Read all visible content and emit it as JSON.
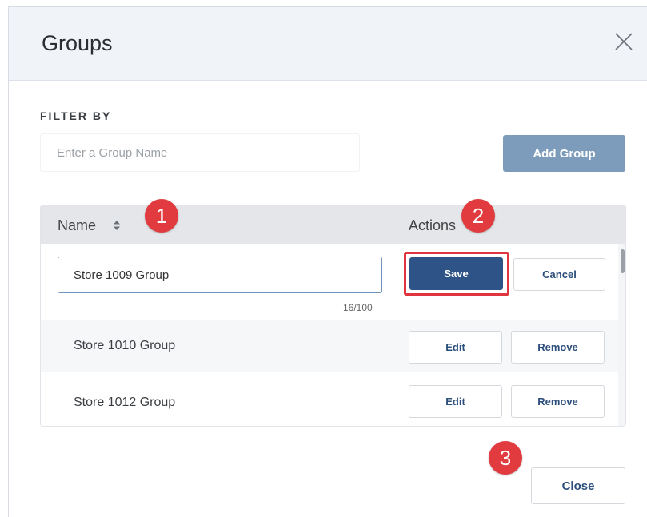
{
  "dialog": {
    "title": "Groups",
    "close_icon": "close-icon"
  },
  "filter": {
    "label": "FILTER BY",
    "placeholder": "Enter a Group Name",
    "add_button": "Add Group"
  },
  "table": {
    "columns": {
      "name": "Name",
      "actions": "Actions",
      "sort_icon": "sort-icon"
    },
    "editing_row": {
      "value": "Store 1009 Group",
      "char_count": "16/100",
      "save_label": "Save",
      "cancel_label": "Cancel"
    },
    "rows": [
      {
        "name": "Store 1010 Group",
        "edit_label": "Edit",
        "remove_label": "Remove"
      },
      {
        "name": "Store 1012 Group",
        "edit_label": "Edit",
        "remove_label": "Remove"
      }
    ]
  },
  "footer": {
    "close_label": "Close"
  },
  "callouts": [
    "1",
    "2",
    "3"
  ],
  "colors": {
    "primary": "#2e5487",
    "add_button": "#7d9cbb",
    "callout": "#e13a3f",
    "header_bg": "#f0f3f8"
  }
}
